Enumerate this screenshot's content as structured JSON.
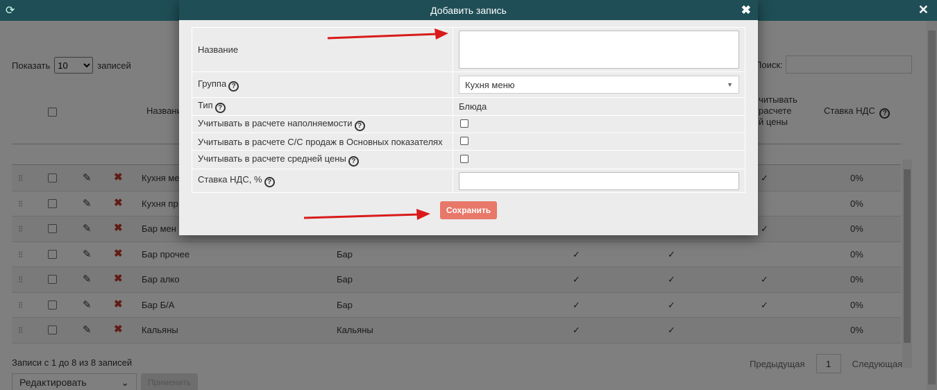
{
  "background": {
    "show": {
      "prefix": "Показать",
      "value": "10",
      "suffix": "записей"
    },
    "search_label": "Поиск:",
    "headers": {
      "name": "Название",
      "avg_price": "учитывать в расчете средней цены",
      "avg_price_lines": [
        "читывать",
        "расчете",
        "й цены"
      ],
      "vat": "Ставка НДС"
    },
    "rows": [
      {
        "name": "Кухня ме",
        "group": "",
        "c1": "",
        "c2": "",
        "c3": "✓",
        "vat": "0%"
      },
      {
        "name": "Кухня пр",
        "group": "",
        "c1": "",
        "c2": "",
        "c3": "",
        "vat": "0%"
      },
      {
        "name": "Бар мен",
        "group": "",
        "c1": "",
        "c2": "",
        "c3": "✓",
        "vat": "0%"
      },
      {
        "name": "Бар прочее",
        "group": "Бар",
        "c1": "✓",
        "c2": "✓",
        "c3": "",
        "vat": "0%"
      },
      {
        "name": "Бар алко",
        "group": "Бар",
        "c1": "✓",
        "c2": "✓",
        "c3": "✓",
        "vat": "0%"
      },
      {
        "name": "Бар Б/А",
        "group": "Бар",
        "c1": "✓",
        "c2": "✓",
        "c3": "✓",
        "vat": "0%"
      },
      {
        "name": "Кальяны",
        "group": "Кальяны",
        "c1": "✓",
        "c2": "✓",
        "c3": "",
        "vat": "0%"
      }
    ],
    "footer_info": "Записи с 1 до 8 из 8 записей",
    "pager": {
      "prev": "Предыдущая",
      "page": "1",
      "next": "Следующая"
    },
    "bulk": {
      "action": "Редактировать",
      "apply": "Применить"
    }
  },
  "modal": {
    "title": "Добавить запись",
    "fields": {
      "name_label": "Название",
      "group_label": "Группа",
      "group_value": "Кухня меню",
      "type_label": "Тип",
      "type_value": "Блюда",
      "fill_label": "Учитывать в расчете наполняемости",
      "cost_label": "Учитывать в расчете С/С продаж в Основных показателях",
      "avg_label": "Учитывать в расчете средней цены",
      "vat_label": "Ставка НДС, %"
    },
    "save_label": "Сохранить"
  },
  "colors": {
    "header": "#1f4e57",
    "save_button": "#e8786a",
    "arrow": "#d91a1a"
  }
}
